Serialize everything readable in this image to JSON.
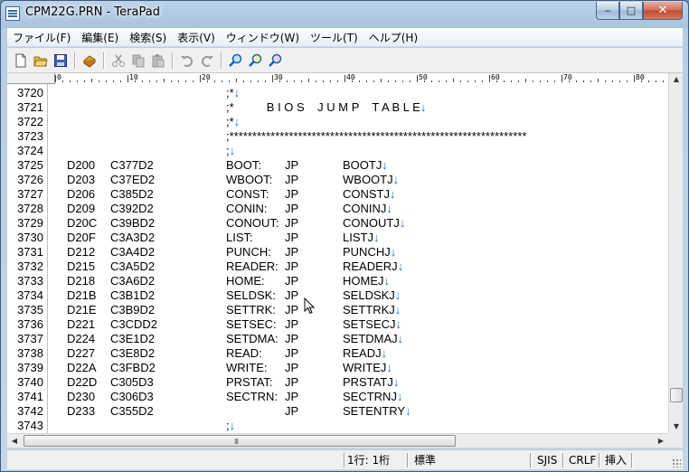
{
  "window": {
    "title": "CPM22G.PRN - TeraPad",
    "minimize": "‒",
    "maximize": "□",
    "close": "✕"
  },
  "menu": [
    "ファイル(F)",
    "編集(E)",
    "検索(S)",
    "表示(V)",
    "ウィンドウ(W)",
    "ツール(T)",
    "ヘルプ(H)"
  ],
  "toolbar_icons": [
    "new-file-icon",
    "open-folder-icon",
    "save-icon",
    "print-icon",
    "cut-icon",
    "copy-icon",
    "paste-icon",
    "undo-icon",
    "redo-icon",
    "find-icon",
    "find-next-icon",
    "find-prev-icon"
  ],
  "ruler": {
    "marks": [
      "0",
      "10",
      "20",
      "30",
      "40",
      "50",
      "60",
      "70",
      "80"
    ]
  },
  "eol_mark": "↓",
  "lines": [
    {
      "no": "3720",
      "c1": "",
      "c2": "",
      "label": ";*",
      "op": "",
      "arg": "",
      "eol": true
    },
    {
      "no": "3721",
      "c1": "",
      "c2": "",
      "label": ";*          B I O S    J U M P    T A B L E",
      "op": "",
      "arg": "",
      "eol": true
    },
    {
      "no": "3722",
      "c1": "",
      "c2": "",
      "label": ";*",
      "op": "",
      "arg": "",
      "eol": true
    },
    {
      "no": "3723",
      "c1": "",
      "c2": "",
      "label": ";*****************************************************************",
      "op": "",
      "arg": "",
      "eol": false
    },
    {
      "no": "3724",
      "c1": "",
      "c2": "",
      "label": ";",
      "op": "",
      "arg": "",
      "eol": true
    },
    {
      "no": "3725",
      "c1": "D200",
      "c2": "C377D2",
      "label": "BOOT:",
      "op": "JP",
      "arg": "BOOTJ",
      "eol": true
    },
    {
      "no": "3726",
      "c1": "D203",
      "c2": "C37ED2",
      "label": "WBOOT:",
      "op": "JP",
      "arg": "WBOOTJ",
      "eol": true
    },
    {
      "no": "3727",
      "c1": "D206",
      "c2": "C385D2",
      "label": "CONST:",
      "op": "JP",
      "arg": "CONSTJ",
      "eol": true
    },
    {
      "no": "3728",
      "c1": "D209",
      "c2": "C392D2",
      "label": "CONIN:",
      "op": "JP",
      "arg": "CONINJ",
      "eol": true
    },
    {
      "no": "3729",
      "c1": "D20C",
      "c2": "C39BD2",
      "label": "CONOUT:",
      "op": "JP",
      "arg": "CONOUTJ",
      "eol": true
    },
    {
      "no": "3730",
      "c1": "D20F",
      "c2": "C3A3D2",
      "label": "LIST:",
      "op": "JP",
      "arg": "LISTJ",
      "eol": true
    },
    {
      "no": "3731",
      "c1": "D212",
      "c2": "C3A4D2",
      "label": "PUNCH:",
      "op": "JP",
      "arg": "PUNCHJ",
      "eol": true
    },
    {
      "no": "3732",
      "c1": "D215",
      "c2": "C3A5D2",
      "label": "READER:",
      "op": "JP",
      "arg": "READERJ",
      "eol": true
    },
    {
      "no": "3733",
      "c1": "D218",
      "c2": "C3A6D2",
      "label": "HOME:",
      "op": "JP",
      "arg": "HOMEJ",
      "eol": true
    },
    {
      "no": "3734",
      "c1": "D21B",
      "c2": "C3B1D2",
      "label": "SELDSK:",
      "op": "JP",
      "arg": "SELDSKJ",
      "eol": true
    },
    {
      "no": "3735",
      "c1": "D21E",
      "c2": "C3B9D2",
      "label": "SETTRK:",
      "op": "JP",
      "arg": "SETTRKJ",
      "eol": true
    },
    {
      "no": "3736",
      "c1": "D221",
      "c2": "C3CDD2",
      "label": "SETSEC:",
      "op": "JP",
      "arg": "SETSECJ",
      "eol": true
    },
    {
      "no": "3737",
      "c1": "D224",
      "c2": "C3E1D2",
      "label": "SETDMA:",
      "op": "JP",
      "arg": "SETDMAJ",
      "eol": true
    },
    {
      "no": "3738",
      "c1": "D227",
      "c2": "C3E8D2",
      "label": "READ:",
      "op": "JP",
      "arg": "READJ",
      "eol": true
    },
    {
      "no": "3739",
      "c1": "D22A",
      "c2": "C3FBD2",
      "label": "WRITE:",
      "op": "JP",
      "arg": "WRITEJ",
      "eol": true
    },
    {
      "no": "3740",
      "c1": "D22D",
      "c2": "C305D3",
      "label": "PRSTAT:",
      "op": "JP",
      "arg": "PRSTATJ",
      "eol": true
    },
    {
      "no": "3741",
      "c1": "D230",
      "c2": "C306D3",
      "label": "SECTRN:",
      "op": "JP",
      "arg": "SECTRNJ",
      "eol": true
    },
    {
      "no": "3742",
      "c1": "D233",
      "c2": "C355D2",
      "label": "",
      "op": "JP",
      "arg": "SETENTRY",
      "eol": true
    },
    {
      "no": "3743",
      "c1": "",
      "c2": "",
      "label": ";",
      "op": "",
      "arg": "",
      "eol": true
    }
  ],
  "scroll": {
    "up": "▲",
    "down": "▼",
    "left": "◀",
    "right": "▶",
    "grip": "III"
  },
  "status": {
    "position": "1行:    1桁",
    "mode": "標準",
    "encoding": "SJIS",
    "newline": "CRLF",
    "insert": "挿入"
  }
}
